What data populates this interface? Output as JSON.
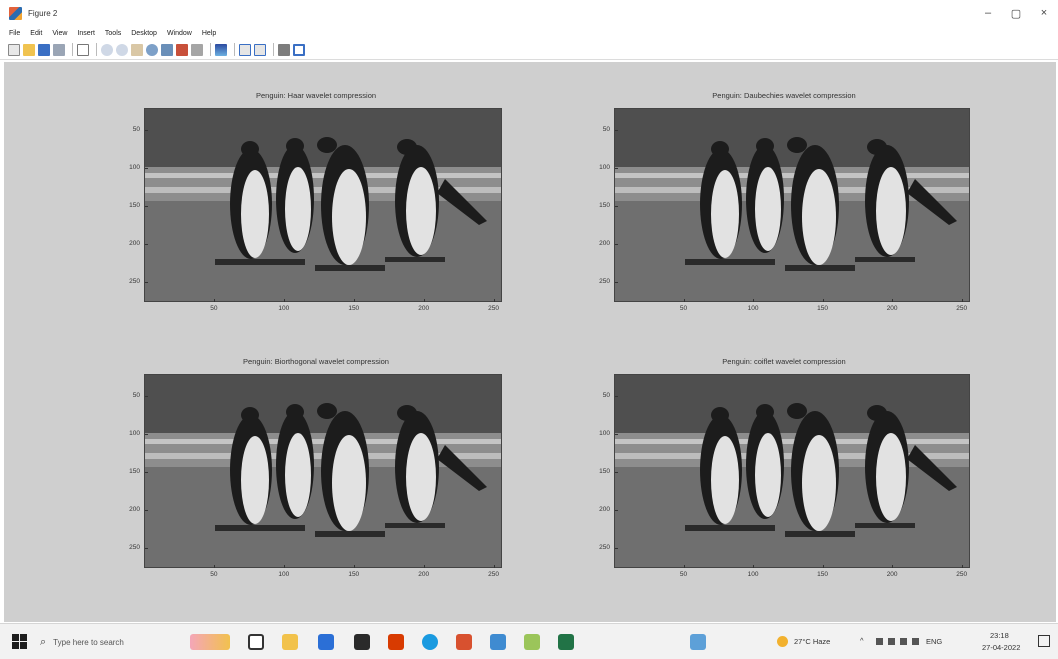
{
  "window": {
    "title": "Figure 2",
    "controls": {
      "minimize": "–",
      "maximize": "▢",
      "close": "×"
    }
  },
  "menu": [
    "File",
    "Edit",
    "View",
    "Insert",
    "Tools",
    "Desktop",
    "Window",
    "Help"
  ],
  "toolbar": [
    "new-figure",
    "open-file",
    "save",
    "print",
    "pointer",
    "zoom-in",
    "zoom-out",
    "pan",
    "rotate-3d",
    "data-cursor",
    "brush",
    "link",
    "colorbar",
    "legend",
    "hide-tools",
    "show-tools"
  ],
  "subplots": [
    {
      "title": "Penguin: Haar wavelet compression",
      "yticks": [
        "50",
        "100",
        "150",
        "200",
        "250"
      ],
      "xticks": [
        "50",
        "100",
        "150",
        "200",
        "250"
      ]
    },
    {
      "title": "Penguin: Daubechies wavelet compression",
      "yticks": [
        "50",
        "100",
        "150",
        "200",
        "250"
      ],
      "xticks": [
        "50",
        "100",
        "150",
        "200",
        "250"
      ]
    },
    {
      "title": "Penguin: Biorthogonal wavelet compression",
      "yticks": [
        "50",
        "100",
        "150",
        "200",
        "250"
      ],
      "xticks": [
        "50",
        "100",
        "150",
        "200",
        "250"
      ]
    },
    {
      "title": "Penguin: coiflet wavelet compression",
      "yticks": [
        "50",
        "100",
        "150",
        "200",
        "250"
      ],
      "xticks": [
        "50",
        "100",
        "150",
        "200",
        "250"
      ]
    }
  ],
  "taskbar": {
    "search_placeholder": "Type here to search",
    "weather": "27°C Haze",
    "time": "23:18",
    "date": "27-04-2022",
    "lang": "ENG",
    "apps": [
      "weather-widget",
      "task-view",
      "file-explorer",
      "store",
      "dropbox",
      "office",
      "chrome",
      "matlab",
      "photos",
      "notepad",
      "excel",
      "teams"
    ]
  }
}
